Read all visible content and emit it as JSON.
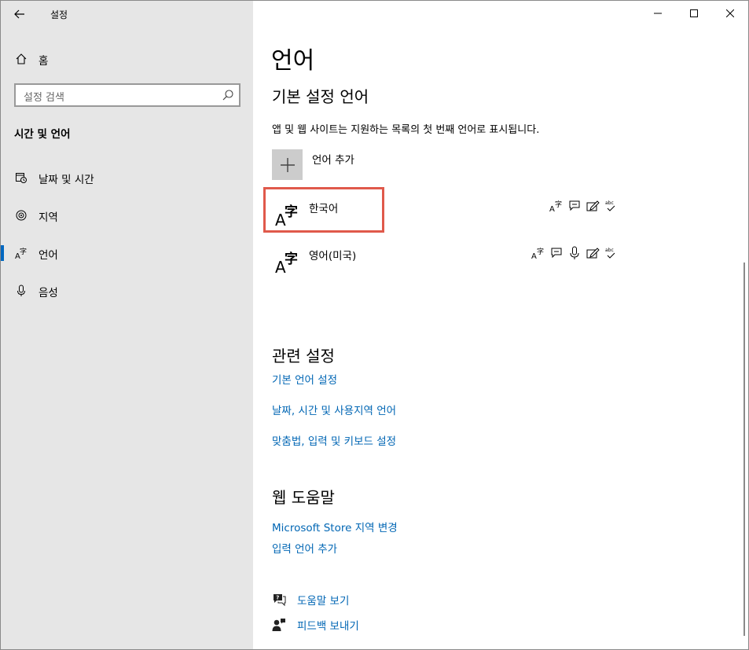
{
  "window": {
    "app_title": "설정"
  },
  "sidebar": {
    "home_label": "홈",
    "search_placeholder": "설정 검색",
    "section_title": "시간 및 언어",
    "items": [
      {
        "label": "날짜 및 시간",
        "icon": "calendar-clock-icon"
      },
      {
        "label": "지역",
        "icon": "globe-icon"
      },
      {
        "label": "언어",
        "icon": "language-icon",
        "active": true
      },
      {
        "label": "음성",
        "icon": "microphone-icon"
      }
    ]
  },
  "main": {
    "page_title": "언어",
    "preferred": {
      "heading": "기본 설정 언어",
      "description": "앱 및 웹 사이트는 지원하는 목록의 첫 번째 언어로 표시됩니다.",
      "add_label": "언어 추가",
      "languages": [
        {
          "name": "한국어",
          "features": [
            "display-language-icon",
            "speech-icon",
            "handwriting-icon",
            "spellcheck-icon"
          ]
        },
        {
          "name": "영어(미국)",
          "features": [
            "display-language-icon",
            "speech-icon",
            "microphone-icon",
            "handwriting-icon",
            "spellcheck-icon"
          ]
        }
      ]
    },
    "related": {
      "heading": "관련 설정",
      "links": [
        "기본 언어 설정",
        "날짜, 시간 및 사용지역 언어",
        "맞춤법, 입력 및 키보드 설정"
      ]
    },
    "web_help": {
      "heading": "웹 도움말",
      "links": [
        "Microsoft Store 지역 변경",
        "입력 언어 추가"
      ]
    },
    "footer": {
      "help_label": "도움말 보기",
      "feedback_label": "피드백 보내기"
    }
  },
  "colors": {
    "accent": "#0067c0",
    "link": "#0066b4",
    "highlight": "#e0594b",
    "sidebar_bg": "#e6e6e6"
  }
}
